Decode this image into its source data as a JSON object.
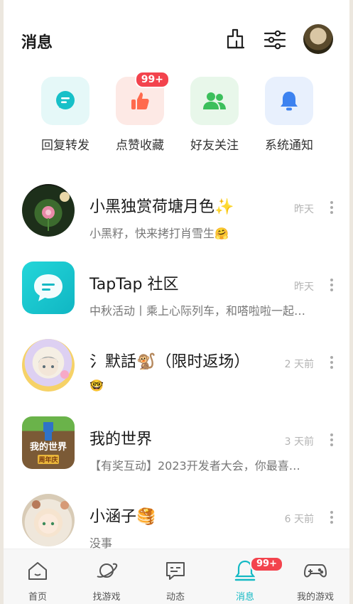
{
  "header": {
    "title": "消息",
    "icons": [
      "broom-icon",
      "filter-sliders-icon"
    ],
    "avatar": "user-avatar"
  },
  "quick": [
    {
      "label": "回复转发",
      "icon": "chat-bubble-icon",
      "bg": "#e5f8f8",
      "color": "#17c0c8"
    },
    {
      "label": "点赞收藏",
      "icon": "thumbs-up-icon",
      "bg": "#fde9e5",
      "color": "#ff6a4d",
      "badge": "99+"
    },
    {
      "label": "好友关注",
      "icon": "friends-icon",
      "bg": "#e8f7ea",
      "color": "#3cbf5c"
    },
    {
      "label": "系统通知",
      "icon": "bell-icon",
      "bg": "#e8f0fd",
      "color": "#3d82f0"
    }
  ],
  "messages": [
    {
      "name": "小黑独赏荷塘月色✨",
      "preview": "小黑籽，快来拷打肖雪生🤗",
      "time": "昨天"
    },
    {
      "name": "TapTap 社区",
      "preview": "中秋活动丨乘上心际列车，和嗒啦啦一起…",
      "time": "昨天"
    },
    {
      "name": "氵默話🐒（限时返场）",
      "preview": "🤓",
      "time": "2 天前"
    },
    {
      "name": "我的世界",
      "preview": "【有奖互动】2023开发者大会，你最喜…",
      "time": "3 天前"
    },
    {
      "name": "小涵子🥞",
      "preview": "没事",
      "time": "6 天前"
    }
  ],
  "minecraft_logo_text": "我的世界 周年庆",
  "nav": [
    {
      "label": "首页",
      "icon": "home-icon"
    },
    {
      "label": "找游戏",
      "icon": "planet-icon"
    },
    {
      "label": "动态",
      "icon": "feed-icon"
    },
    {
      "label": "消息",
      "icon": "message-bell-icon",
      "badge": "99+",
      "active": true
    },
    {
      "label": "我的游戏",
      "icon": "gamepad-icon"
    }
  ],
  "colors": {
    "accent": "#14b9c4",
    "badge": "#f3434d"
  }
}
